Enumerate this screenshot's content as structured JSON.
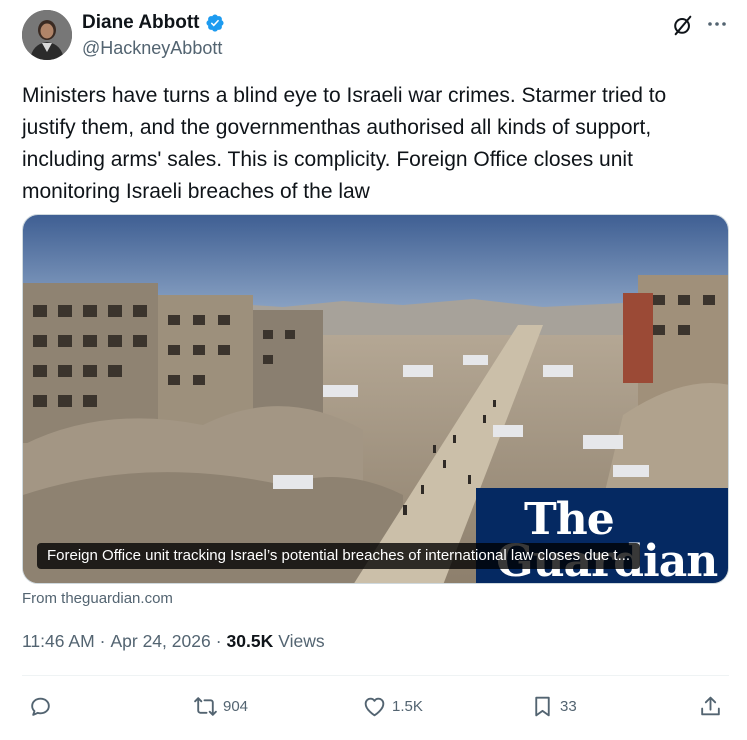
{
  "author": {
    "display_name": "Diane Abbott",
    "handle": "@HackneyAbbott"
  },
  "tweet": {
    "text": "Ministers have turns a blind eye to Israeli war crimes. Starmer tried to justify them, and the governmenthas authorised all kinds of support, including arms' sales. This is complicity. Foreign Office closes unit monitoring Israeli breaches of the law"
  },
  "card": {
    "logo_line1": "The",
    "logo_line2": "Guardian",
    "caption": "Foreign Office unit tracking Israel’s potential breaches of international law closes due t...",
    "source": "From theguardian.com"
  },
  "meta": {
    "time": "11:46 AM",
    "date": "Apr 24, 2026",
    "views_count": "30.5K",
    "views_label": "Views",
    "separator": "·"
  },
  "actions": {
    "reply_count": "",
    "repost_count": "904",
    "like_count": "1.5K",
    "bookmark_count": "33"
  },
  "colors": {
    "verified": "#1d9bf0",
    "guardian_blue": "#052962",
    "muted_text": "#536471"
  },
  "icons": [
    "verified-badge-icon",
    "grok-icon",
    "more-icon",
    "reply-icon",
    "repost-icon",
    "like-icon",
    "bookmark-icon",
    "share-icon"
  ]
}
